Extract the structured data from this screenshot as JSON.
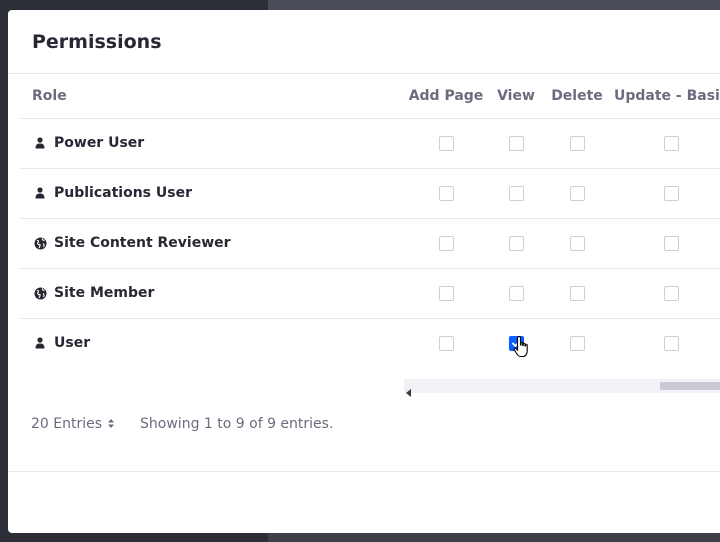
{
  "modal": {
    "title": "Permissions"
  },
  "table": {
    "columns": [
      "Role",
      "Add Page",
      "View",
      "Delete",
      "Update - Basic"
    ],
    "rows": [
      {
        "role": "Power User",
        "icon": "user-icon",
        "add_page": false,
        "view": false,
        "delete": false,
        "update_basic": false
      },
      {
        "role": "Publications User",
        "icon": "user-icon",
        "add_page": false,
        "view": false,
        "delete": false,
        "update_basic": false
      },
      {
        "role": "Site Content Reviewer",
        "icon": "globe-icon",
        "add_page": false,
        "view": false,
        "delete": false,
        "update_basic": false
      },
      {
        "role": "Site Member",
        "icon": "globe-icon",
        "add_page": false,
        "view": false,
        "delete": false,
        "update_basic": false
      },
      {
        "role": "User",
        "icon": "user-icon",
        "add_page": false,
        "view": true,
        "delete": false,
        "update_basic": false
      }
    ]
  },
  "pagination": {
    "entries_label": "20 Entries",
    "showing_text": "Showing 1 to 9 of 9 entries."
  },
  "icons": {
    "entries_sort": "sort-caret-icon",
    "scroll_left": "caret-left-icon",
    "cursor": "hand-pointer-icon"
  },
  "colors": {
    "accent": "#0b5fff",
    "text_primary": "#272833",
    "text_secondary": "#6b6c7e"
  }
}
